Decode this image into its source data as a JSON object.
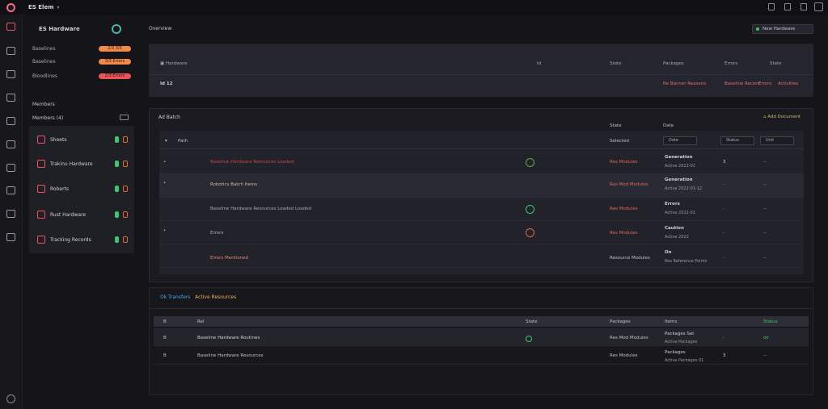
{
  "header": {
    "title": "ES Elem"
  },
  "sidebar": {
    "title": "ES Hardware",
    "stats": [
      {
        "label": "Baselines",
        "value": "2/3 3/3",
        "color": "#f08a4b"
      },
      {
        "label": "Baselines",
        "value": "3/3 Errors",
        "color": "#f08a4b"
      },
      {
        "label": "Bloodlines",
        "value": "2/3 Errors",
        "color": "#e8555b"
      }
    ],
    "section_label": "Members",
    "section_sub": "Members (4)",
    "items": [
      {
        "name": "Sheets"
      },
      {
        "name": "Trakinu Hardware"
      },
      {
        "name": "Roberts"
      },
      {
        "name": "Rust Hardware"
      },
      {
        "name": "Tracking Records"
      }
    ]
  },
  "main": {
    "title": "Overview",
    "action": "New Hardware",
    "summary": {
      "headers": [
        "Hardware",
        "Id",
        "State",
        "Packages",
        "Errors",
        "State"
      ],
      "values": [
        "Id 12",
        "Re Banner Reasons",
        "Baseline Recent",
        "Errors",
        "Activities"
      ]
    },
    "detail": {
      "title": "Ad Batch",
      "link": "Add Document",
      "col_headers": [
        "State",
        "Date"
      ],
      "filter_label": "Path",
      "filter_state": "Selected",
      "filter_date": "Date",
      "filter_box1": "Status",
      "filter_box2": "Unit",
      "rows": [
        {
          "name": "Baseline Hardware Resources Loaded",
          "state": "Res Modules",
          "date": "Generation",
          "sub": "Active 2022-01",
          "count": "3",
          "dot": "--"
        },
        {
          "name": "Robotics Batch Items",
          "state": "Res Mod Modules",
          "date": "Generation",
          "sub": "Active 2022-01-12",
          "count": "-",
          "dot": "--"
        },
        {
          "name": "Baseline Hardware Resources Loaded Loaded",
          "state": "Res Modules",
          "date": "Errors",
          "sub": "Active 2022-01",
          "count": "-",
          "dot": "--"
        },
        {
          "name": "Errors",
          "state": "Res Modules",
          "date": "Caution",
          "sub": "Active 2022",
          "count": "-",
          "dot": "--"
        },
        {
          "name": "Errors Mentioned",
          "state": "Resource Modules",
          "date": "On",
          "sub": "Res Reference Points",
          "count": "-",
          "dot": "--"
        }
      ]
    },
    "notes": {
      "title_a": "Ok Transfers",
      "title_b": "Active Resources",
      "headers": [
        "B",
        "Rel",
        "State",
        "Packages",
        "Items",
        "Status"
      ],
      "rows": [
        {
          "b": "B",
          "name": "Baseline Hardware Routines",
          "state": "Res Mod Modules",
          "pkg": "Packages Set",
          "sub": "Active Packages",
          "items": "-",
          "status": "ok"
        },
        {
          "b": "B",
          "name": "Baseline Hardware Resources",
          "state": "Res Modules",
          "pkg": "Packages",
          "sub": "Active Packages 01",
          "items": "3",
          "status": "--"
        }
      ]
    }
  },
  "colors": {
    "accent": "#e8555b",
    "orange": "#f08a4b",
    "green": "#43c46a"
  }
}
